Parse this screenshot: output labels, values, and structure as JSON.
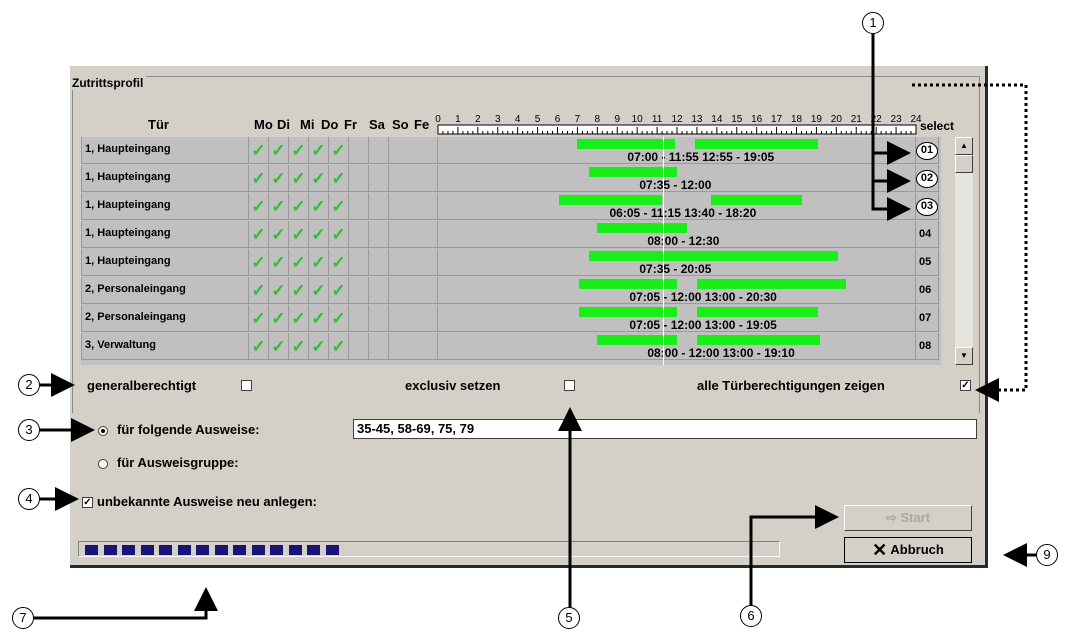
{
  "group": {
    "title": "Zutrittsprofil"
  },
  "columns": {
    "door": "Tür",
    "days": [
      "Mo",
      "Di",
      "Mi",
      "Do",
      "Fr",
      "Sa",
      "So",
      "Fe"
    ],
    "hours": [
      "0",
      "1",
      "2",
      "3",
      "4",
      "5",
      "6",
      "7",
      "8",
      "9",
      "10",
      "11",
      "12",
      "13",
      "14",
      "15",
      "16",
      "17",
      "18",
      "19",
      "20",
      "21",
      "22",
      "23",
      "24"
    ],
    "select": "select"
  },
  "rows": [
    {
      "door": "1, Haupteingang",
      "days": [
        true,
        true,
        true,
        true,
        true,
        false,
        false,
        false
      ],
      "bars": [
        [
          7.0,
          11.9
        ],
        [
          12.9,
          19.1
        ]
      ],
      "times": "07:00 - 11:55  12:55 - 19:05",
      "select": "01"
    },
    {
      "door": "1, Haupteingang",
      "days": [
        true,
        true,
        true,
        true,
        true,
        false,
        false,
        false
      ],
      "bars": [
        [
          7.6,
          12.0
        ]
      ],
      "times": "07:35 - 12:00",
      "select": "02"
    },
    {
      "door": "1, Haupteingang",
      "days": [
        true,
        true,
        true,
        true,
        true,
        false,
        false,
        false
      ],
      "bars": [
        [
          6.1,
          11.25
        ],
        [
          13.7,
          18.3
        ]
      ],
      "times": "06:05 - 11:15  13:40 - 18:20",
      "select": "03"
    },
    {
      "door": "1, Haupteingang",
      "days": [
        true,
        true,
        true,
        true,
        true,
        false,
        false,
        false
      ],
      "bars": [
        [
          8.0,
          12.5
        ]
      ],
      "times": "08:00 - 12:30",
      "select": "04"
    },
    {
      "door": "1, Haupteingang",
      "days": [
        true,
        true,
        true,
        true,
        true,
        false,
        false,
        false
      ],
      "bars": [
        [
          7.6,
          20.1
        ]
      ],
      "times": "07:35 - 20:05",
      "select": "05"
    },
    {
      "door": "2, Personaleingang",
      "days": [
        true,
        true,
        true,
        true,
        true,
        false,
        false,
        false
      ],
      "bars": [
        [
          7.1,
          12.0
        ],
        [
          13.0,
          20.5
        ]
      ],
      "times": "07:05 - 12:00  13:00 - 20:30",
      "select": "06"
    },
    {
      "door": "2, Personaleingang",
      "days": [
        true,
        true,
        true,
        true,
        true,
        false,
        false,
        false
      ],
      "bars": [
        [
          7.1,
          12.0
        ],
        [
          13.0,
          19.1
        ]
      ],
      "times": "07:05 - 12:00  13:00 - 19:05",
      "select": "07"
    },
    {
      "door": "3, Verwaltung",
      "days": [
        true,
        true,
        true,
        true,
        true,
        false,
        false,
        false
      ],
      "bars": [
        [
          8.0,
          12.0
        ],
        [
          13.0,
          19.2
        ]
      ],
      "times": "08:00 - 12:00  13:00 - 19:10",
      "select": "08"
    }
  ],
  "options": {
    "generalberechtigt": {
      "label": "generalberechtigt",
      "checked": false
    },
    "exclusiv": {
      "label": "exclusiv setzen",
      "checked": false
    },
    "alle": {
      "label": "alle Türberechtigungen zeigen",
      "checked": true
    }
  },
  "ausweise": {
    "radio1_label": "für folgende Ausweise:",
    "radio1_selected": true,
    "value": "35-45, 58-69, 75, 79",
    "radio2_label": "für Ausweisgruppe:",
    "radio2_selected": false
  },
  "unbekannte": {
    "label": "unbekannte Ausweise neu anlegen:",
    "checked": true
  },
  "buttons": {
    "start": "Start",
    "abbruch": "Abbruch"
  },
  "progress": {
    "filled_blocks": 14
  },
  "callouts": [
    "1",
    "2",
    "3",
    "4",
    "5",
    "6",
    "7",
    "9"
  ],
  "colors": {
    "bar": "#18ee18",
    "progress": "#1b1477",
    "panel": "#d4d0c8"
  },
  "icons": {
    "check": "check-icon",
    "start": "arrow-right-icon",
    "abbruch": "x-icon"
  }
}
